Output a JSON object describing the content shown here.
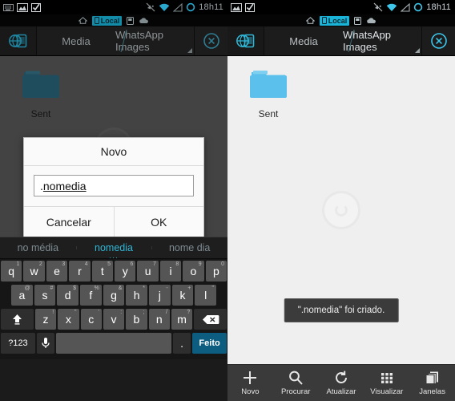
{
  "status_bar": {
    "time": "18h11",
    "left_icons": [
      "keyboard-icon",
      "gallery-icon",
      "checkbox-icon"
    ],
    "right_icons": [
      "vibrate-off-icon",
      "wifi-icon",
      "signal-icon",
      "sync-icon"
    ]
  },
  "location_bar": {
    "home_icon": "home-icon",
    "active_label": "Local",
    "icons": [
      "home-icon",
      "phone-icon",
      "sdcard-icon",
      "cloud-icon"
    ]
  },
  "breadcrumb": {
    "device_icon": "device-globe-icon",
    "segments": [
      {
        "label": "Media"
      },
      {
        "label": "WhatsApp Images"
      }
    ],
    "close_icon": "close-circle-icon"
  },
  "files": [
    {
      "name": "Sent",
      "icon": "folder-icon"
    }
  ],
  "dialog": {
    "title": "Novo",
    "input_value_prefix": ".",
    "input_value_composing": "nomedia",
    "input_placeholder": "",
    "cancel_label": "Cancelar",
    "ok_label": "OK"
  },
  "toast": {
    "message": "\".nomedia\" foi criado."
  },
  "toolbar": {
    "items": [
      {
        "label": "Novo",
        "icon": "plus-icon"
      },
      {
        "label": "Procurar",
        "icon": "search-icon"
      },
      {
        "label": "Atualizar",
        "icon": "refresh-icon"
      },
      {
        "label": "Visualizar",
        "icon": "grid-icon"
      },
      {
        "label": "Janelas",
        "icon": "windows-icon"
      }
    ]
  },
  "keyboard": {
    "suggestions": [
      {
        "text": "no média",
        "active": false
      },
      {
        "text": "nomedia",
        "active": true
      },
      {
        "text": "nome dia",
        "active": false
      }
    ],
    "row1": [
      {
        "k": "q",
        "sup": "1"
      },
      {
        "k": "w",
        "sup": "2"
      },
      {
        "k": "e",
        "sup": "3"
      },
      {
        "k": "r",
        "sup": "4"
      },
      {
        "k": "t",
        "sup": "5"
      },
      {
        "k": "y",
        "sup": "6"
      },
      {
        "k": "u",
        "sup": "7"
      },
      {
        "k": "i",
        "sup": "8"
      },
      {
        "k": "o",
        "sup": "9"
      },
      {
        "k": "p",
        "sup": "0"
      }
    ],
    "row2": [
      {
        "k": "a",
        "sup": "@"
      },
      {
        "k": "s",
        "sup": "#"
      },
      {
        "k": "d",
        "sup": "$"
      },
      {
        "k": "f",
        "sup": "%"
      },
      {
        "k": "g",
        "sup": "&"
      },
      {
        "k": "h",
        "sup": "*"
      },
      {
        "k": "j",
        "sup": "-"
      },
      {
        "k": "k",
        "sup": "+"
      },
      {
        "k": "l",
        "sup": "\""
      }
    ],
    "row3": [
      {
        "k": "z",
        "sup": "!"
      },
      {
        "k": "x",
        "sup": "\""
      },
      {
        "k": "c",
        "sup": "'"
      },
      {
        "k": "v",
        "sup": ":"
      },
      {
        "k": "b",
        "sup": ";"
      },
      {
        "k": "n",
        "sup": "/"
      },
      {
        "k": "m",
        "sup": "?"
      }
    ],
    "shift_icon": "shift-icon",
    "backspace_icon": "backspace-icon",
    "symbols_label": "?123",
    "mic_icon": "microphone-icon",
    "space_label": "",
    "period_label": ".",
    "done_label": "Feito"
  },
  "colors": {
    "accent": "#1ab4d8",
    "folder": "#5bc0eb",
    "done_key": "#0d5d80",
    "file_bg": "#efefef",
    "dim_file_bg": "#606060"
  }
}
